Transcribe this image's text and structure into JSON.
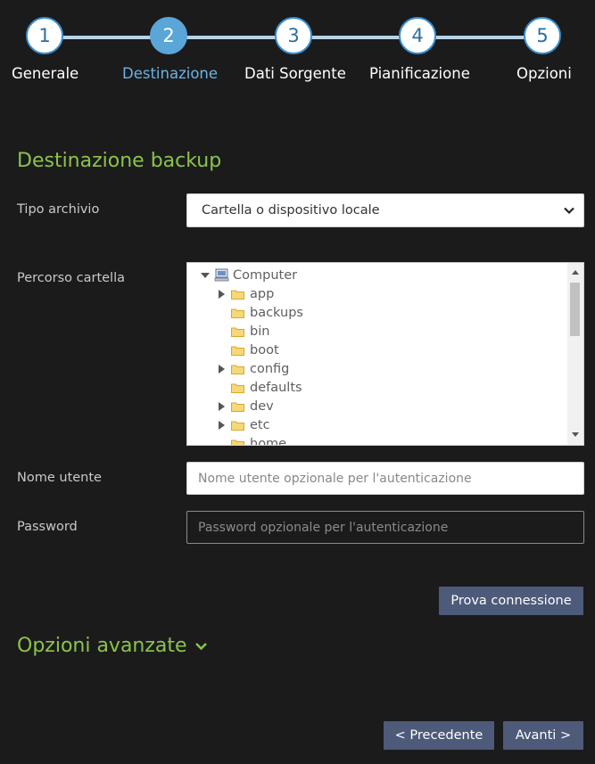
{
  "stepper": {
    "steps": [
      {
        "number": "1",
        "label": "Generale",
        "active": false
      },
      {
        "number": "2",
        "label": "Destinazione",
        "active": true
      },
      {
        "number": "3",
        "label": "Dati Sorgente",
        "active": false
      },
      {
        "number": "4",
        "label": "Pianificazione",
        "active": false
      },
      {
        "number": "5",
        "label": "Opzioni",
        "active": false
      }
    ],
    "colors": {
      "active": "#5aa6d8",
      "active_label": "#6bb3e3",
      "line": "#b9d3e6"
    }
  },
  "destination": {
    "title": "Destinazione backup",
    "archive_type_label": "Tipo archivio",
    "archive_type_value": "Cartella o dispositivo locale",
    "folder_path_label": "Percorso cartella",
    "tree": {
      "root": "Computer",
      "items": [
        "app",
        "backups",
        "bin",
        "boot",
        "config",
        "defaults",
        "dev",
        "etc",
        "home"
      ]
    },
    "username_label": "Nome utente",
    "username_placeholder": "Nome utente opzionale per l'autenticazione",
    "password_label": "Password",
    "password_placeholder": "Password opzionale per l'autenticazione",
    "test_button": "Prova connessione"
  },
  "advanced": {
    "title": "Opzioni avanzate"
  },
  "nav": {
    "prev": "< Precedente",
    "next": "Avanti >"
  },
  "colors": {
    "accent_green": "#8bc34a",
    "button": "#4d5a79",
    "background": "#1b1b1c"
  }
}
